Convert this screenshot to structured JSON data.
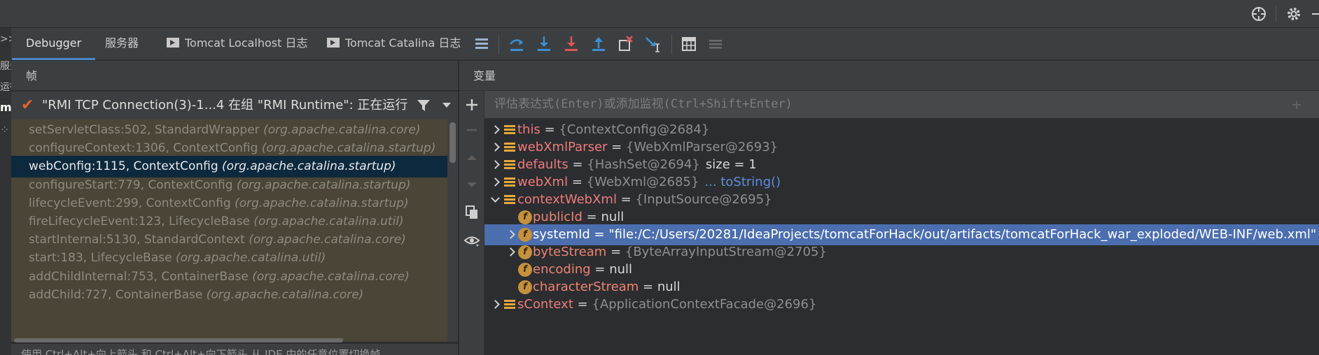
{
  "top_toolbar": {
    "crosshair_icon": "crosshair-icon",
    "settings_icon": "gear-icon",
    "hide_icon": "minus-icon"
  },
  "left_strip": {
    "labels": [
      ">>",
      "服务",
      "运行",
      "m"
    ]
  },
  "tabs": [
    {
      "label": "Debugger",
      "active": true
    },
    {
      "label": "服务器",
      "active": false
    },
    {
      "label": "Tomcat Localhost 日志",
      "active": false
    },
    {
      "label": "Tomcat Catalina 日志",
      "active": false
    }
  ],
  "frames_panel": {
    "title": "帧",
    "thread": "\"RMI TCP Connection(3)-1...4 在组 \"RMI Runtime\": 正在运行",
    "frames": [
      {
        "method": "setServletClass:502, StandardWrapper",
        "pkg": "(org.apache.catalina.core)"
      },
      {
        "method": "configureContext:1306, ContextConfig",
        "pkg": "(org.apache.catalina.startup)"
      },
      {
        "method": "webConfig:1115, ContextConfig",
        "pkg": "(org.apache.catalina.startup)",
        "selected": true
      },
      {
        "method": "configureStart:779, ContextConfig",
        "pkg": "(org.apache.catalina.startup)"
      },
      {
        "method": "lifecycleEvent:299, ContextConfig",
        "pkg": "(org.apache.catalina.startup)"
      },
      {
        "method": "fireLifecycleEvent:123, LifecycleBase",
        "pkg": "(org.apache.catalina.util)"
      },
      {
        "method": "startInternal:5130, StandardContext",
        "pkg": "(org.apache.catalina.core)"
      },
      {
        "method": "start:183, LifecycleBase",
        "pkg": "(org.apache.catalina.util)"
      },
      {
        "method": "addChildInternal:753, ContainerBase",
        "pkg": "(org.apache.catalina.core)"
      },
      {
        "method": "addChild:727, ContainerBase",
        "pkg": "(org.apache.catalina.core)"
      }
    ],
    "tip": "使用 Ctrl+Alt+向上箭头 和 Ctrl+Alt+向下箭头 从 IDE 中的任意位置切换帧"
  },
  "variables_panel": {
    "title": "变量",
    "eval_placeholder": "评估表达式(Enter)或添加监视(Ctrl+Shift+Enter)",
    "rows": [
      {
        "name": "this",
        "eq": " = ",
        "value": "{ContextConfig@2684}",
        "extra": "",
        "kind": "local",
        "depth": 0,
        "arrow": "right"
      },
      {
        "name": "webXmlParser",
        "eq": " = ",
        "value": "{WebXmlParser@2693}",
        "extra": "",
        "kind": "local",
        "depth": 0,
        "arrow": "right"
      },
      {
        "name": "defaults",
        "eq": " = ",
        "value": "{HashSet@2694}",
        "extra": "size = 1",
        "kind": "local",
        "depth": 0,
        "arrow": "right"
      },
      {
        "name": "webXml",
        "eq": " = ",
        "value": "{WebXml@2685}",
        "extra": "... toString()",
        "kind": "local",
        "depth": 0,
        "arrow": "right"
      },
      {
        "name": "contextWebXml",
        "eq": " = ",
        "value": "{InputSource@2695}",
        "extra": "",
        "kind": "local",
        "depth": 0,
        "arrow": "down"
      },
      {
        "name": "publicId",
        "eq": " = ",
        "value": "null",
        "extra": "",
        "kind": "field",
        "depth": 1,
        "arrow": "none"
      },
      {
        "name": "systemId",
        "eq": " = ",
        "value": "\"file:/C:/Users/20281/IdeaProjects/tomcatForHack/out/artifacts/tomcatForHack_war_exploded/WEB-INF/web.xml\"",
        "extra": "",
        "kind": "field",
        "depth": 1,
        "arrow": "right",
        "selected": true
      },
      {
        "name": "byteStream",
        "eq": " = ",
        "value": "{ByteArrayInputStream@2705}",
        "extra": "",
        "kind": "field",
        "depth": 1,
        "arrow": "right"
      },
      {
        "name": "encoding",
        "eq": " = ",
        "value": "null",
        "extra": "",
        "kind": "field",
        "depth": 1,
        "arrow": "none"
      },
      {
        "name": "characterStream",
        "eq": " = ",
        "value": "null",
        "extra": "",
        "kind": "field",
        "depth": 1,
        "arrow": "none"
      },
      {
        "name": "sContext",
        "eq": " = ",
        "value": "{ApplicationContextFacade@2696}",
        "extra": "",
        "kind": "local",
        "depth": 0,
        "arrow": "right"
      }
    ]
  },
  "debug_toolbar": {
    "icons": [
      "frames-icon",
      "step-over-icon",
      "step-into-icon",
      "force-step-into-icon",
      "step-out-icon",
      "drop-frame-icon",
      "run-to-cursor-icon",
      "evaluate-icon",
      "trace-icon"
    ]
  },
  "colors": {
    "accent": "#4a88c7",
    "selection": "#4b6eaf",
    "frame_selection": "#0d293e",
    "breakpoint_check": "#e0642a"
  }
}
